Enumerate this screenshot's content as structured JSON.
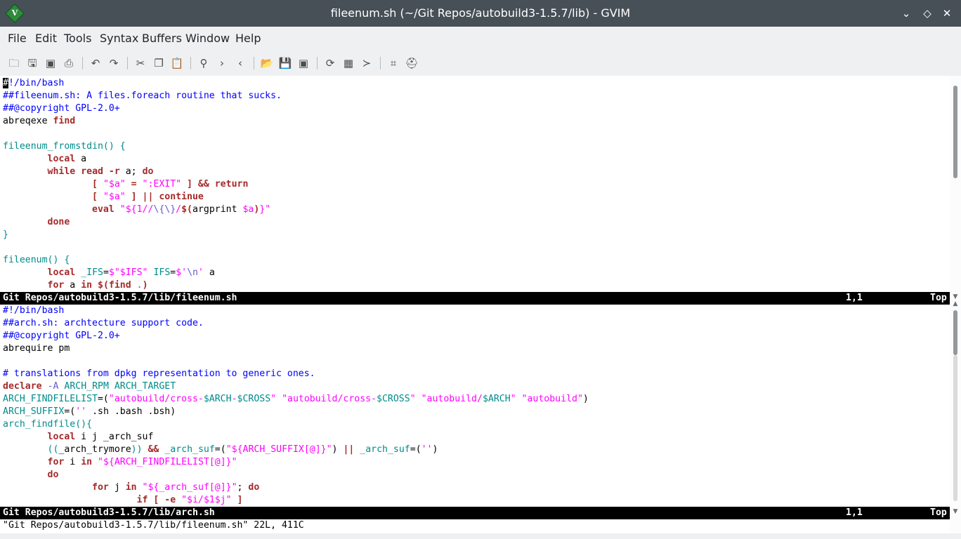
{
  "window": {
    "title": "fileenum.sh (~/Git Repos/autobuild3-1.5.7/lib) - GVIM",
    "logo_letter": "V",
    "controls": {
      "minimize": "⌄",
      "maximize": "◇",
      "close": "✕"
    }
  },
  "menu": [
    "File",
    "Edit",
    "Tools",
    "Syntax",
    "Buffers",
    "Window",
    "Help"
  ],
  "toolbar": {
    "icons": [
      "open-icon",
      "save-icon",
      "save-all-icon",
      "print-icon",
      "undo-icon",
      "redo-icon",
      "cut-icon",
      "copy-icon",
      "paste-icon",
      "find-icon",
      "find-next-icon",
      "find-prev-icon",
      "load-session-icon",
      "save-session-icon",
      "run-script-icon",
      "make-icon",
      "shell-icon",
      "ctags-icon",
      "tag-jump-icon",
      "help-icon"
    ],
    "glyphs": {
      "open": "🗀",
      "save": "🖫",
      "save_all": "▣",
      "print": "⎙",
      "undo": "↶",
      "redo": "↷",
      "cut": "✂",
      "copy": "❐",
      "paste": "📋",
      "find": "⚲",
      "find_next": "›",
      "find_prev": "‹",
      "load_session": "📂",
      "save_session": "💾",
      "run_script": "▣",
      "make": "⟳",
      "shell": "▦",
      "ctags": "≻",
      "tag_jump": "⌗",
      "help": "⛑"
    }
  },
  "window1": {
    "lines": [
      [
        [
          "cursor",
          "#"
        ],
        [
          "cmt",
          "!/bin/bash"
        ]
      ],
      [
        [
          "cmt",
          "##fileenum.sh: A files.foreach routine that sucks."
        ]
      ],
      [
        [
          "cmt",
          "##@copyright GPL-2.0+"
        ]
      ],
      [
        [
          "",
          "abreqexe "
        ],
        [
          "stmt",
          "find"
        ]
      ],
      [
        [
          "",
          ""
        ]
      ],
      [
        [
          "fn",
          "fileenum_fromstdin() {"
        ]
      ],
      [
        [
          "",
          "        "
        ],
        [
          "stmt",
          "local"
        ],
        [
          "",
          " a"
        ]
      ],
      [
        [
          "",
          "        "
        ],
        [
          "stmt",
          "while"
        ],
        [
          "",
          " "
        ],
        [
          "stmt",
          "read"
        ],
        [
          "",
          " "
        ],
        [
          "stmt",
          "-r"
        ],
        [
          "",
          " a; "
        ],
        [
          "stmt",
          "do"
        ]
      ],
      [
        [
          "",
          "                "
        ],
        [
          "stmt",
          "[ "
        ],
        [
          "str",
          "\"$a\""
        ],
        [
          "stmt",
          " = "
        ],
        [
          "str",
          "\":EXIT\""
        ],
        [
          "stmt",
          " ] && return"
        ]
      ],
      [
        [
          "",
          "                "
        ],
        [
          "stmt",
          "[ "
        ],
        [
          "str",
          "\"$a\""
        ],
        [
          "stmt",
          " ] || continue"
        ]
      ],
      [
        [
          "",
          "                "
        ],
        [
          "stmt",
          "eval "
        ],
        [
          "str",
          "\"${1//"
        ],
        [
          "spc",
          "\\{\\}"
        ],
        [
          "str",
          "/"
        ],
        [
          "stmt",
          "$("
        ],
        [
          "",
          "argprint "
        ],
        [
          "str",
          "$a"
        ],
        [
          "stmt",
          ")"
        ],
        [
          "str",
          "}\""
        ]
      ],
      [
        [
          "",
          "        "
        ],
        [
          "stmt",
          "done"
        ]
      ],
      [
        [
          "fn",
          "}"
        ]
      ],
      [
        [
          "",
          ""
        ]
      ],
      [
        [
          "fn",
          "fileenum() {"
        ]
      ],
      [
        [
          "",
          "        "
        ],
        [
          "stmt",
          "local"
        ],
        [
          "",
          " "
        ],
        [
          "fn",
          "_IFS"
        ],
        [
          "",
          "="
        ],
        [
          "str",
          "$\"$IFS\""
        ],
        [
          "",
          " "
        ],
        [
          "fn",
          "IFS"
        ],
        [
          "",
          "="
        ],
        [
          "str",
          "$'"
        ],
        [
          "spc",
          "\\n"
        ],
        [
          "str",
          "'"
        ],
        [
          "",
          " a"
        ]
      ],
      [
        [
          "",
          "        "
        ],
        [
          "stmt",
          "for"
        ],
        [
          "",
          " a "
        ],
        [
          "stmt",
          "in"
        ],
        [
          "",
          " "
        ],
        [
          "stmt",
          "$("
        ],
        [
          "stmt",
          "find"
        ],
        [
          "",
          " "
        ],
        [
          "spc",
          "."
        ],
        [
          "stmt",
          ")"
        ]
      ]
    ],
    "status": {
      "name": "Git Repos/autobuild3-1.5.7/lib/fileenum.sh",
      "pos": "1,1",
      "pct": "Top"
    }
  },
  "window2": {
    "lines": [
      [
        [
          "cmt",
          "#!/bin/bash"
        ]
      ],
      [
        [
          "cmt",
          "##arch.sh: archtecture support code."
        ]
      ],
      [
        [
          "cmt",
          "##@copyright GPL-2.0+"
        ]
      ],
      [
        [
          "",
          "abrequire pm"
        ]
      ],
      [
        [
          "",
          ""
        ]
      ],
      [
        [
          "cmt",
          "# translations from dpkg representation to generic ones."
        ]
      ],
      [
        [
          "stmt",
          "declare"
        ],
        [
          "",
          " "
        ],
        [
          "spc",
          "-A"
        ],
        [
          "",
          " "
        ],
        [
          "fn",
          "ARCH_RPM ARCH_TARGET"
        ]
      ],
      [
        [
          "fn",
          "ARCH_FINDFILELIST"
        ],
        [
          "",
          "=("
        ],
        [
          "str",
          "\"autobuild/cross-"
        ],
        [
          "fn",
          "$ARCH"
        ],
        [
          "str",
          "-"
        ],
        [
          "fn",
          "$CROSS"
        ],
        [
          "str",
          "\""
        ],
        [
          "",
          " "
        ],
        [
          "str",
          "\"autobuild/cross-"
        ],
        [
          "fn",
          "$CROSS"
        ],
        [
          "str",
          "\""
        ],
        [
          "",
          " "
        ],
        [
          "str",
          "\"autobuild/"
        ],
        [
          "fn",
          "$ARCH"
        ],
        [
          "str",
          "\""
        ],
        [
          "",
          " "
        ],
        [
          "str",
          "\"autobuild\""
        ],
        [
          "",
          ")"
        ]
      ],
      [
        [
          "fn",
          "ARCH_SUFFIX"
        ],
        [
          "",
          "=("
        ],
        [
          "str",
          "''"
        ],
        [
          "",
          " .sh .bash .bsh)"
        ]
      ],
      [
        [
          "fn",
          "arch_findfile(){"
        ]
      ],
      [
        [
          "",
          "        "
        ],
        [
          "stmt",
          "local"
        ],
        [
          "",
          " i j _arch_suf"
        ]
      ],
      [
        [
          "",
          "        "
        ],
        [
          "fn",
          "(("
        ],
        [
          "",
          "_arch_trymore"
        ],
        [
          "fn",
          "))"
        ],
        [
          "",
          " "
        ],
        [
          "stmt",
          "&&"
        ],
        [
          "",
          " "
        ],
        [
          "fn",
          "_arch_suf"
        ],
        [
          "",
          "=("
        ],
        [
          "str",
          "\"${ARCH_SUFFIX[@]}\""
        ],
        [
          "",
          ") "
        ],
        [
          "stmt",
          "||"
        ],
        [
          "",
          " "
        ],
        [
          "fn",
          "_arch_suf"
        ],
        [
          "",
          "=("
        ],
        [
          "str",
          "''"
        ],
        [
          "",
          ")"
        ]
      ],
      [
        [
          "",
          "        "
        ],
        [
          "stmt",
          "for"
        ],
        [
          "",
          " i "
        ],
        [
          "stmt",
          "in"
        ],
        [
          "",
          " "
        ],
        [
          "str",
          "\"${ARCH_FINDFILELIST[@]}\""
        ]
      ],
      [
        [
          "",
          "        "
        ],
        [
          "stmt",
          "do"
        ]
      ],
      [
        [
          "",
          "                "
        ],
        [
          "stmt",
          "for"
        ],
        [
          "",
          " j "
        ],
        [
          "stmt",
          "in"
        ],
        [
          "",
          " "
        ],
        [
          "str",
          "\"${_arch_suf[@]}\""
        ],
        [
          "",
          "; "
        ],
        [
          "stmt",
          "do"
        ]
      ],
      [
        [
          "",
          "                        "
        ],
        [
          "stmt",
          "if [ -e "
        ],
        [
          "str",
          "\"$i/$1$j\""
        ],
        [
          "stmt",
          " ]"
        ]
      ]
    ],
    "status": {
      "name": "Git Repos/autobuild3-1.5.7/lib/arch.sh",
      "pos": "1,1",
      "pct": "Top"
    }
  },
  "cmdline": "\"Git Repos/autobuild3-1.5.7/lib/fileenum.sh\" 22L, 411C"
}
